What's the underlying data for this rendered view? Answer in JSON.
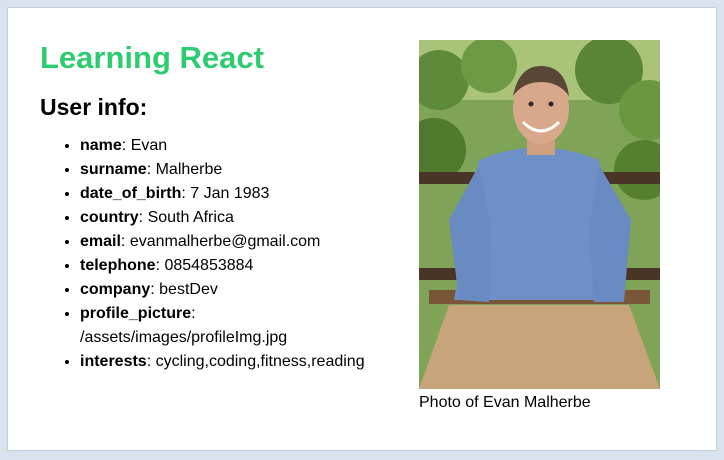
{
  "app": {
    "title": "Learning React",
    "subtitle": "User info:",
    "accent_color": "#2ecc71"
  },
  "user": {
    "fields": [
      {
        "key": "name",
        "value": ": Evan"
      },
      {
        "key": "surname",
        "value": ": Malherbe"
      },
      {
        "key": "date_of_birth",
        "value": ": 7 Jan 1983"
      },
      {
        "key": "country",
        "value": ": South Africa"
      },
      {
        "key": "email",
        "value": ": evanmalherbe@gmail.com"
      },
      {
        "key": "telephone",
        "value": ": 0854853884"
      },
      {
        "key": "company",
        "value": ": bestDev"
      },
      {
        "key": "profile_picture",
        "value": ": /assets/images/profileImg.jpg"
      },
      {
        "key": "interests",
        "value": ": cycling,coding,fitness,reading"
      }
    ]
  },
  "photo": {
    "caption": "Photo of Evan Malherbe",
    "icon": "profile-photo"
  }
}
